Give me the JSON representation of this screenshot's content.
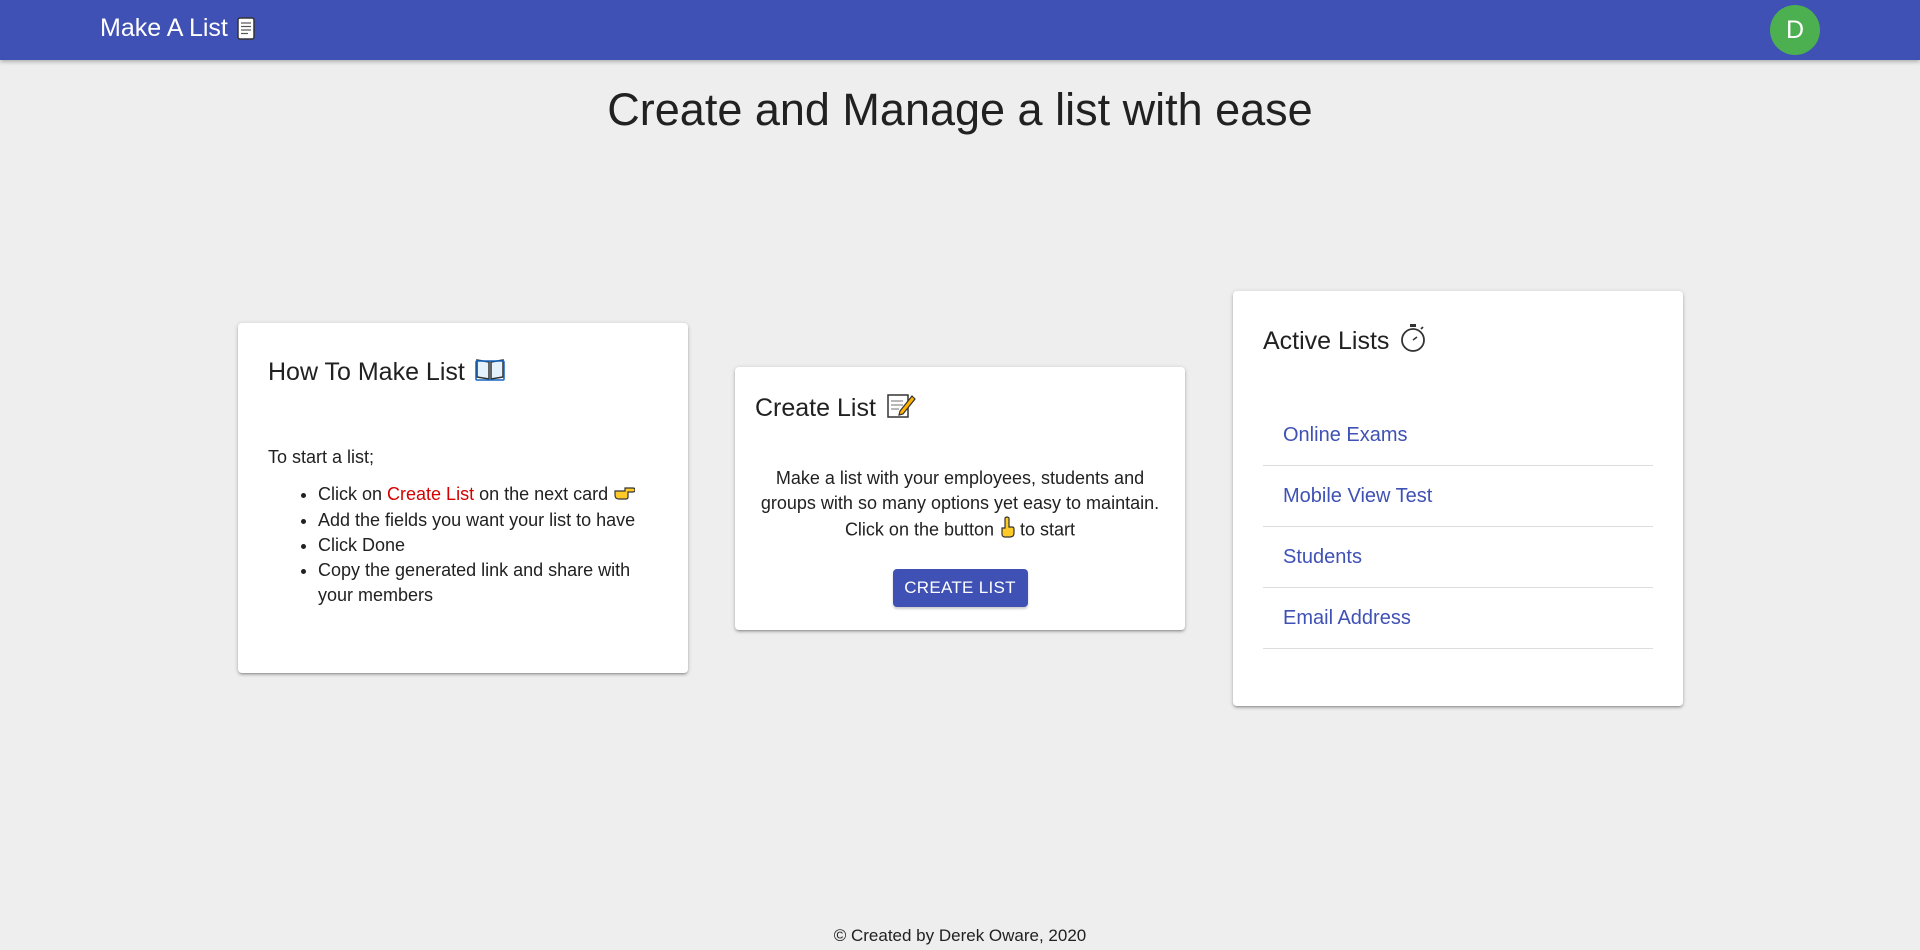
{
  "appbar": {
    "title": "Make A List",
    "avatar_letter": "D",
    "colors": {
      "bar": "#3f51b5",
      "avatar": "#4caf50"
    }
  },
  "headline": "Create and Manage a list with ease",
  "how_to_card": {
    "title": "How To Make List",
    "intro": "To start a list;",
    "step1_prefix": "Click on ",
    "step1_highlight": "Create List",
    "step1_suffix": " on the next card",
    "step2": "Add the fields you want your list to have",
    "step3": "Click Done",
    "step4": "Copy the generated link and share with your members"
  },
  "create_card": {
    "title": "Create List",
    "description_part1": "Make a list with your employees, students and groups with so many options yet easy to maintain. Click on the button ",
    "description_part2": " to start",
    "button_label": "CREATE LIST"
  },
  "active_card": {
    "title": "Active Lists",
    "items": [
      {
        "label": "Online Exams"
      },
      {
        "label": "Mobile View Test"
      },
      {
        "label": "Students"
      },
      {
        "label": "Email Address"
      }
    ]
  },
  "footer": "© Created by Derek Oware, 2020",
  "icons": {
    "brand": "scroll-icon",
    "how_to": "open-book-icon",
    "step1": "pointing-right-icon",
    "create": "memo-icon",
    "create_desc": "pointing-down-icon",
    "active": "stopwatch-icon"
  }
}
